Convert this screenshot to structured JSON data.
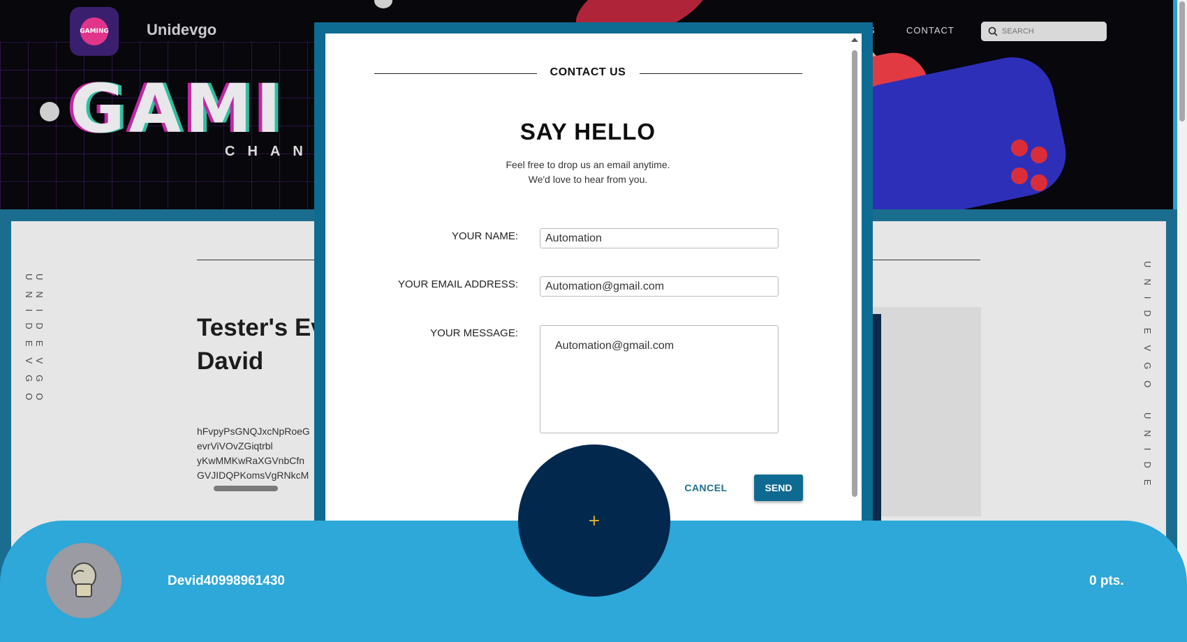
{
  "site": {
    "brand": "Unidevgo",
    "hero_word": "GAMI",
    "hero_sub": "CHANN",
    "logo_text": "GAMING",
    "nav_partial": "S",
    "nav_contact": "CONTACT",
    "search_placeholder": "SEARCH",
    "side_left": "UNIDEVGO UNIDEVGO",
    "side_right": "UNIDEVGO UNIDE"
  },
  "post": {
    "title_line1": "Tester's Ev",
    "title_line2": "David",
    "lines": [
      "hFvpyPsGNQJxcNpRoeG",
      "evrViVOvZGiqtrbl",
      "yKwMMKwRaXGVnbCfn",
      "GVJIDQPKomsVgRNkcM"
    ]
  },
  "modal": {
    "header": "CONTACT US",
    "heading": "SAY HELLO",
    "subtitle_1": "Feel free to drop us an email anytime.",
    "subtitle_2": "We'd love to hear from you.",
    "name_label": "YOUR NAME:",
    "name_value": "Automation",
    "email_label": "YOUR EMAIL ADDRESS:",
    "email_value": "Automation@gmail.com",
    "message_label": "YOUR MESSAGE:",
    "message_value": "Automation@gmail.com",
    "cancel_label": "CANCEL",
    "send_label": "SEND"
  },
  "bottom": {
    "username": "Devid40998961430",
    "points": "0 pts.",
    "fab_label": "+"
  }
}
